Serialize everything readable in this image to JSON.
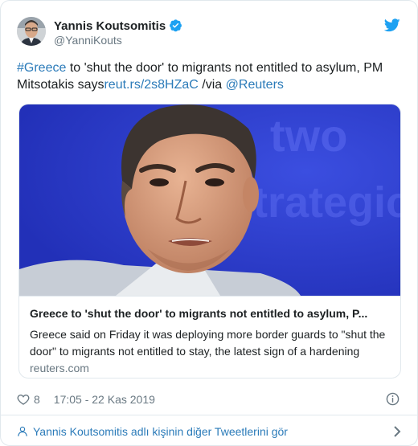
{
  "author": {
    "display_name": "Yannis Koutsomitis",
    "handle": "@YanniKouts",
    "verified": true
  },
  "tweet": {
    "hashtag": "#Greece",
    "text_before_link": " to 'shut the door' to migrants not entitled to asylum, PM Mitsotakis says",
    "link_text": "reut.rs/2s8HZaC",
    "via_text": " /via ",
    "mention": "@Reuters"
  },
  "card": {
    "background_text": "Strategic Part",
    "title": "Greece to 'shut the door' to migrants not entitled to asylum, P...",
    "description": "Greece said on Friday it was deploying more border guards to \"shut the door\" to migrants not entitled to stay, the latest sign of a hardening",
    "domain": "reuters.com"
  },
  "footer": {
    "like_count": "8",
    "timestamp": "17:05 - 22 Kas 2019",
    "more_tweets_label": "Yannis Koutsomitis adlı kişinin diğer Tweetlerini gör"
  },
  "colors": {
    "link": "#2b7bb9",
    "secondary_text": "#697882",
    "twitter_blue": "#1da1f2",
    "card_background": "#2a37c8"
  },
  "icons": [
    "verified-badge-icon",
    "twitter-bird-icon",
    "heart-icon",
    "info-icon",
    "person-icon",
    "chevron-right-icon"
  ]
}
